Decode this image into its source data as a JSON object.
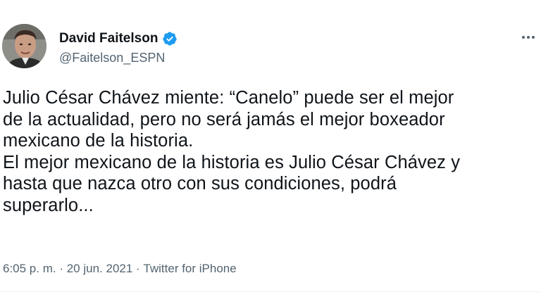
{
  "author": {
    "display_name": "David Faitelson",
    "handle": "@Faitelson_ESPN",
    "verified": true,
    "verified_color": "#1d9bf0",
    "avatar_icon": "profile-photo"
  },
  "tweet": {
    "text": "Julio César Chávez miente: “Canelo” puede ser el mejor\nde la actualidad, pero no será jamás el mejor boxeador\nmexicano de la historia.\nEl mejor mexicano de la historia es Julio César Chávez y\nhasta que nazca otro con sus condiciones, podrá\nsuperarlo...",
    "time": "6:05 p. m.",
    "separator": " · ",
    "date": "20 jun. 2021",
    "source": "Twitter for iPhone"
  },
  "actions": {
    "more_icon": "more-horizontal-icon"
  },
  "colors": {
    "text": "#0f1419",
    "secondary": "#536471"
  }
}
